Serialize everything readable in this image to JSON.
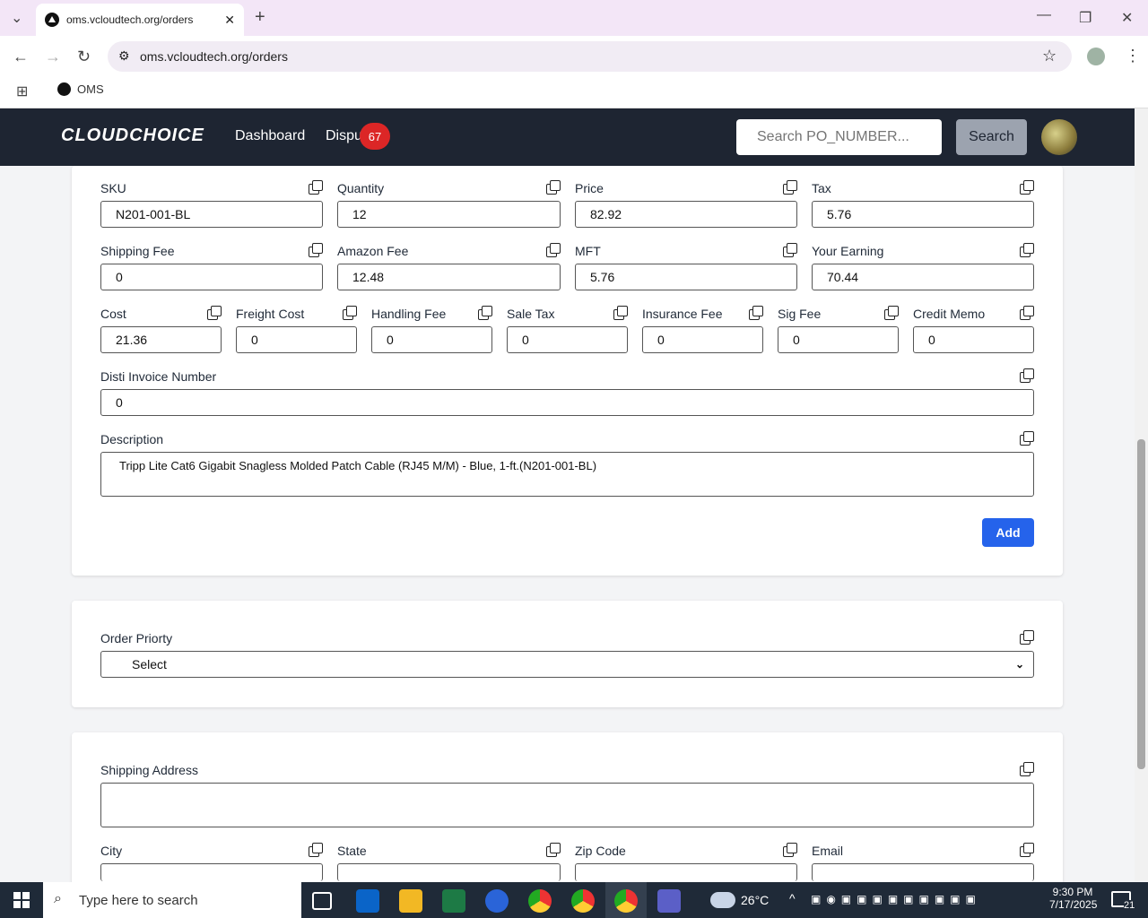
{
  "browser": {
    "tab_title": "oms.vcloudtech.org/orders",
    "url": "oms.vcloudtech.org/orders",
    "bookmark": "OMS"
  },
  "nav": {
    "logo": "CLOUDCHOICE",
    "dashboard": "Dashboard",
    "disputes": "Dispu",
    "disputes_badge": "67",
    "search_placeholder": "Search PO_NUMBER...",
    "search_button": "Search"
  },
  "item": {
    "sku_label": "SKU",
    "sku": "N201-001-BL",
    "quantity_label": "Quantity",
    "quantity": "12",
    "price_label": "Price",
    "price": "82.92",
    "tax_label": "Tax",
    "tax": "5.76",
    "shipping_fee_label": "Shipping Fee",
    "shipping_fee": "0",
    "amazon_fee_label": "Amazon Fee",
    "amazon_fee": "12.48",
    "mft_label": "MFT",
    "mft": "5.76",
    "earning_label": "Your Earning",
    "earning": "70.44",
    "cost_label": "Cost",
    "cost": "21.36",
    "freight_label": "Freight Cost",
    "freight": "0",
    "handling_label": "Handling Fee",
    "handling": "0",
    "sale_tax_label": "Sale Tax",
    "sale_tax": "0",
    "insurance_label": "Insurance Fee",
    "insurance": "0",
    "sig_label": "Sig Fee",
    "sig": "0",
    "credit_label": "Credit Memo",
    "credit": "0",
    "disti_label": "Disti Invoice Number",
    "disti": "0",
    "description_label": "Description",
    "description": "Tripp Lite Cat6 Gigabit Snagless Molded Patch Cable (RJ45 M/M) - Blue, 1-ft.(N201-001-BL)",
    "add_button": "Add"
  },
  "priority": {
    "label": "Order Priorty",
    "selected": "Select"
  },
  "shipping": {
    "address_label": "Shipping Address",
    "city_label": "City",
    "state_label": "State",
    "zip_label": "Zip Code",
    "email_label": "Email"
  },
  "taskbar": {
    "search_placeholder": "Type here to search",
    "weather": "26°C",
    "time": "9:30 PM",
    "date": "7/17/2025",
    "notifications": "21"
  }
}
